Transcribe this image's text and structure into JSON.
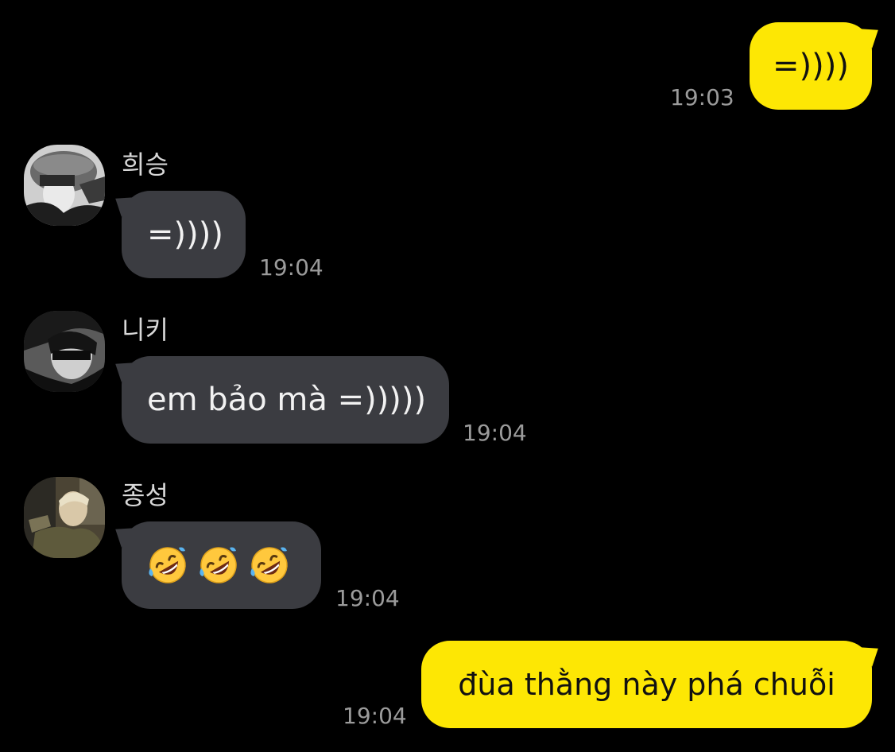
{
  "messages": [
    {
      "from": "me",
      "text": "=))))",
      "time": "19:03"
    },
    {
      "from": "them",
      "sender": "희승",
      "avatar": "avatar-heeseung",
      "text": "=))))",
      "time": "19:04"
    },
    {
      "from": "them",
      "sender": "니키",
      "avatar": "avatar-niki",
      "text": "em bảo mà =)))))",
      "time": "19:04"
    },
    {
      "from": "them",
      "sender": "종성",
      "avatar": "avatar-jongseong",
      "emojis": [
        "rolling-on-floor-laughing-icon",
        "rolling-on-floor-laughing-icon",
        "rolling-on-floor-laughing-icon"
      ],
      "time": "19:04"
    },
    {
      "from": "me",
      "text": "đùa thằng này phá chuỗi",
      "time": "19:04"
    }
  ],
  "colors": {
    "background": "#000000",
    "my_bubble": "#fde704",
    "their_bubble": "#3b3c41",
    "timestamp": "#9b9b9b"
  }
}
